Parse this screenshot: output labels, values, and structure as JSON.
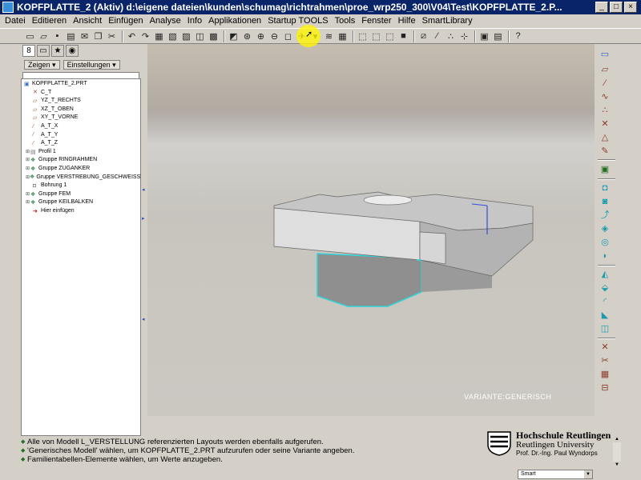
{
  "window": {
    "title": "KOPFPLATTE_2 (Aktiv) d:\\eigene dateien\\kunden\\schumag\\richtrahmen\\proe_wrp250_300\\V04\\Test\\KOPFPLATTE_2.P..."
  },
  "menu": [
    "Datei",
    "Editieren",
    "Ansicht",
    "Einfügen",
    "Analyse",
    "Info",
    "Applikationen",
    "Startup TOOLS",
    "Tools",
    "Fenster",
    "Hilfe",
    "SmartLibrary"
  ],
  "panel": {
    "show_menu": "Zeigen",
    "settings_menu": "Einstellungen"
  },
  "tree": [
    {
      "label": "KOPFPLATTE_2.PRT",
      "icon": "part-icon"
    },
    {
      "label": "C_T",
      "icon": "csys-icon"
    },
    {
      "label": "YZ_T_RECHTS",
      "icon": "datum-plane-icon"
    },
    {
      "label": "XZ_T_OBEN",
      "icon": "datum-plane-icon"
    },
    {
      "label": "XY_T_VORNE",
      "icon": "datum-plane-icon"
    },
    {
      "label": "A_T_X",
      "icon": "datum-axis-icon"
    },
    {
      "label": "A_T_Y",
      "icon": "datum-axis-icon"
    },
    {
      "label": "A_T_Z",
      "icon": "datum-axis-icon"
    },
    {
      "label": "Profil 1",
      "icon": "extrude-icon",
      "expandable": true
    },
    {
      "label": "Gruppe RINGRAHMEN",
      "icon": "group-icon",
      "expandable": true
    },
    {
      "label": "Gruppe ZUGANKER",
      "icon": "group-icon",
      "expandable": true
    },
    {
      "label": "Gruppe VERSTREBUNG_GESCHWEISST",
      "icon": "group-icon",
      "expandable": true
    },
    {
      "label": "Bohrung 1",
      "icon": "hole-icon"
    },
    {
      "label": "Gruppe FEM",
      "icon": "group-icon",
      "expandable": true
    },
    {
      "label": "Gruppe KEILBALKEN",
      "icon": "group-icon",
      "expandable": true
    },
    {
      "label": "Hier einfügen",
      "icon": "insert-arrow-icon"
    }
  ],
  "viewport": {
    "variant_label": "VARIANTE:GENERISCH"
  },
  "messages": [
    "Alle von Modell L_VERSTELLUNG referenzierten Layouts werden ebenfalls aufgerufen.",
    "'Generisches Modell' wählen, um KOPFPLATTE_2.PRT aufzurufen oder seine Variante angeben.",
    "Familientabellen-Elemente wählen, um Werte anzugeben."
  ],
  "logo": {
    "name": "Hochschule Reutlingen",
    "subtitle": "Reutlingen University",
    "professor": "Prof. Dr.-Ing. Paul Wyndorps"
  },
  "filter": {
    "value": "Smart"
  }
}
